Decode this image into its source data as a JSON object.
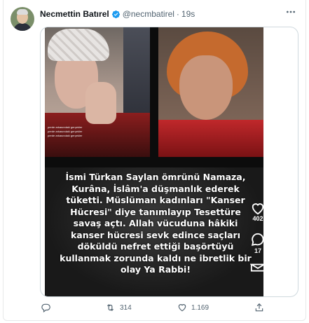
{
  "tweet": {
    "author_name": "Necmettin Batırel",
    "handle": "@necmbatirel",
    "separator": "·",
    "time": "19s",
    "more_icon": "ellipsis-icon",
    "verified_color": "#1d9bf0"
  },
  "media": {
    "overlay_labels": [
      "perde arkasındaki gerçekler",
      "perde arkasındaki gerçekler",
      "perde arkasındaki gerçekler"
    ],
    "caption": "İsmi Türkan Saylan ömrünü Namaza, Kurâna, İslâm'a düşmanlık ederek tüketti. Müslüman kadınları \"Kanser Hücresi\" diye tanımlayıp Tesettüre savaş açtı. Allah vücuduna hâkiki kanser hücresi sevk edince saçları döküldü nefret ettiği başörtüyü kullanmak zorunda kaldı ne ibretlik bir olay Ya Rabbi!",
    "like_count": "402",
    "comment_count": "17"
  },
  "actions": {
    "reply_icon": "reply-icon",
    "retweet_icon": "retweet-icon",
    "retweet_count": "314",
    "like_icon": "like-icon",
    "like_count": "1.169",
    "share_icon": "share-icon"
  }
}
